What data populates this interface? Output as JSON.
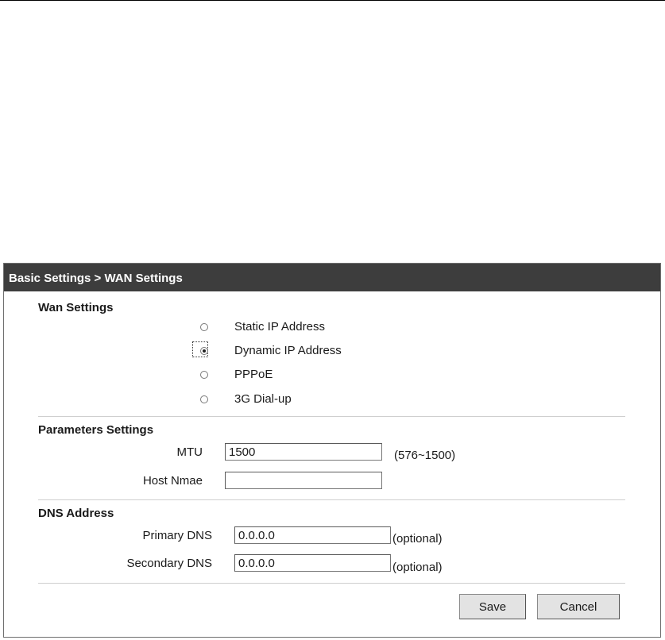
{
  "header": {
    "breadcrumb": "Basic Settings > WAN Settings"
  },
  "wan": {
    "title": "Wan Settings",
    "options": [
      {
        "label": "Static IP Address",
        "checked": false
      },
      {
        "label": "Dynamic IP Address",
        "checked": true
      },
      {
        "label": "PPPoE",
        "checked": false
      },
      {
        "label": "3G Dial-up",
        "checked": false
      }
    ]
  },
  "params": {
    "title": "Parameters Settings",
    "mtu_label": "MTU",
    "mtu_value": "1500",
    "mtu_hint": "(576~1500)",
    "host_label": "Host Nmae",
    "host_value": ""
  },
  "dns": {
    "title": "DNS Address",
    "primary_label": "Primary DNS",
    "primary_value": "0.0.0.0",
    "primary_hint": "(optional)",
    "secondary_label": "Secondary DNS",
    "secondary_value": "0.0.0.0",
    "secondary_hint": "(optional)"
  },
  "buttons": {
    "save": "Save",
    "cancel": "Cancel"
  }
}
